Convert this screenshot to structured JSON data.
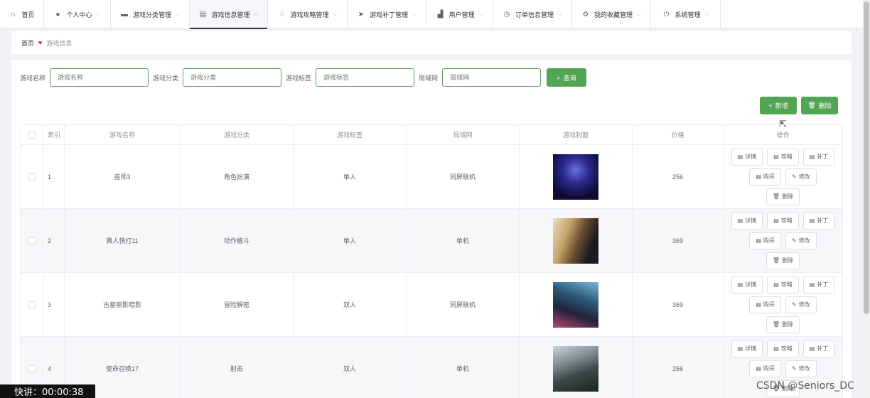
{
  "nav": [
    {
      "label": "首页",
      "icon": "home-icon",
      "glyph": "⌂",
      "width": 62,
      "chevron": false,
      "active": false
    },
    {
      "label": "个人中心",
      "icon": "user-icon",
      "glyph": "●",
      "width": 94,
      "chevron": true,
      "active": false
    },
    {
      "label": "游戏分类管理",
      "icon": "chat-icon",
      "glyph": "▬",
      "width": 111,
      "chevron": true,
      "active": false
    },
    {
      "label": "游戏信息管理",
      "icon": "doc-icon",
      "glyph": "▤",
      "width": 110,
      "chevron": true,
      "active": true
    },
    {
      "label": "游戏攻略管理",
      "icon": "bell-icon",
      "glyph": "♢",
      "width": 112,
      "chevron": true,
      "active": false
    },
    {
      "label": "游戏补丁管理",
      "icon": "send-icon",
      "glyph": "➤",
      "width": 111,
      "chevron": true,
      "active": false
    },
    {
      "label": "用户管理",
      "icon": "chart-icon",
      "glyph": "▟",
      "width": 94,
      "chevron": true,
      "active": false
    },
    {
      "label": "订单信息管理",
      "icon": "clock-icon",
      "glyph": "◷",
      "width": 111,
      "chevron": true,
      "active": false
    },
    {
      "label": "我的收藏管理",
      "icon": "settings-icon",
      "glyph": "⚙",
      "width": 111,
      "chevron": true,
      "active": false
    },
    {
      "label": "系统管理",
      "icon": "power-icon",
      "glyph": "⏻",
      "width": 98,
      "chevron": true,
      "active": false
    }
  ],
  "breadcrumb": {
    "home": "首页",
    "current": "游戏信息"
  },
  "search": {
    "name_label": "游戏名称",
    "name_placeholder": "游戏名称",
    "category_label": "游戏分类",
    "category_placeholder": "游戏分类",
    "tag_label": "游戏标签",
    "tag_placeholder": "游戏标签",
    "lan_label": "局域网",
    "lan_placeholder": "局域网",
    "query_label": "查询"
  },
  "toolbar": {
    "add_label": "新增",
    "delete_label": "删除"
  },
  "table": {
    "headers": [
      "索引",
      "游戏名称",
      "游戏分类",
      "游戏标签",
      "局域网",
      "游戏封面",
      "价格",
      "操作"
    ],
    "rows": [
      {
        "index": "1",
        "name": "巫师3",
        "category": "角色扮演",
        "tag": "单人",
        "lan": "同屏联机",
        "price": "256"
      },
      {
        "index": "2",
        "name": "真人快打11",
        "category": "动作格斗",
        "tag": "单人",
        "lan": "单机",
        "price": "369"
      },
      {
        "index": "3",
        "name": "古墓丽影暗影",
        "category": "冒险解密",
        "tag": "双人",
        "lan": "同屏联机",
        "price": "369"
      },
      {
        "index": "4",
        "name": "使命召唤17",
        "category": "射击",
        "tag": "双人",
        "lan": "单机",
        "price": "256"
      }
    ],
    "actions": {
      "detail": "详情",
      "guide": "攻略",
      "patch": "补丁",
      "buy": "购买",
      "edit": "修改",
      "delete": "删除"
    }
  },
  "overlay": {
    "timer": "快讲：00:00:38",
    "watermark": "CSDN @Seniors_DC"
  },
  "colors": {
    "primary": "#53a553",
    "heart": "#e02020"
  }
}
